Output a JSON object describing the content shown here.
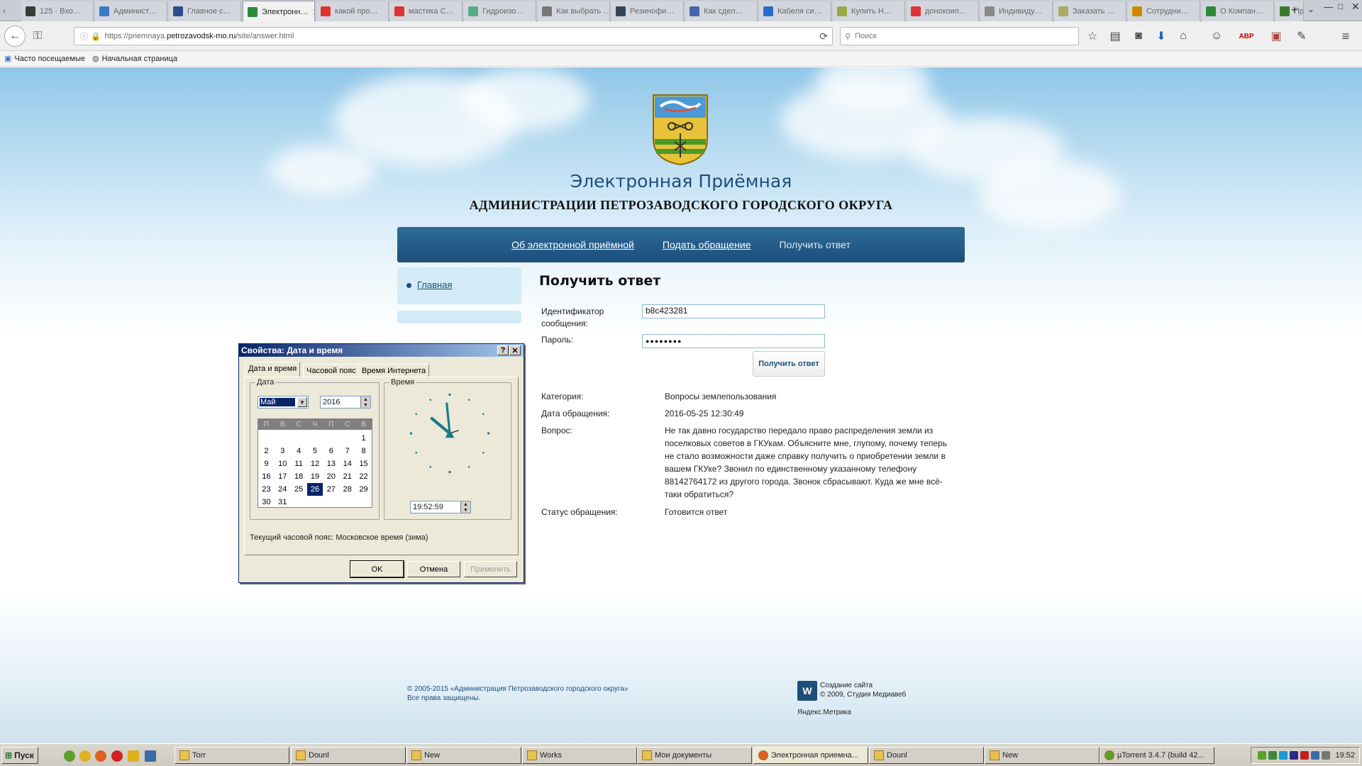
{
  "browser": {
    "tabs": [
      {
        "label": "125 · Вхо…",
        "color": "#3a3a3a"
      },
      {
        "label": "Админист…",
        "color": "#3a7ac8"
      },
      {
        "label": "Главное с…",
        "color": "#2a4f8a"
      },
      {
        "label": "Электронн…",
        "color": "#2a8a3a"
      },
      {
        "label": "какой про…",
        "color": "#d33"
      },
      {
        "label": "мастика С…",
        "color": "#d33"
      },
      {
        "label": "Гидроизо…",
        "color": "#5a8"
      },
      {
        "label": "Как выбрать …",
        "color": "#777"
      },
      {
        "label": "Резинофи…",
        "color": "#345"
      },
      {
        "label": "Как сдел…",
        "color": "#46a"
      },
      {
        "label": "Кабеля си…",
        "color": "#2a6acc"
      },
      {
        "label": "Купить Н…",
        "color": "#9a4"
      },
      {
        "label": "донокоип…",
        "color": "#d33"
      },
      {
        "label": "Индивиду…",
        "color": "#888"
      },
      {
        "label": "Заказать …",
        "color": "#aa6"
      },
      {
        "label": "Сотрудни…",
        "color": "#c80"
      },
      {
        "label": "О Компан…",
        "color": "#2a8a3a"
      },
      {
        "label": "Про…",
        "color": "#3a7a2a"
      }
    ],
    "url_prefix": "https://priemnaya.",
    "url_domain": "petrozavodsk-mo.ru",
    "url_path": "/site/answer.html",
    "search_placeholder": "Поиск",
    "bookmarks": [
      "Часто посещаемые",
      "Начальная страница"
    ]
  },
  "site": {
    "title": "Электронная Приёмная",
    "subtitle": "АДМИНИСТРАЦИИ ПЕТРОЗАВОДСКОГО ГОРОДСКОГО ОКРУГА",
    "menu": [
      "Об электронной приёмной",
      "Подать обращение",
      "Получить ответ"
    ],
    "side_link": "Главная",
    "heading": "Получить ответ",
    "form": {
      "id_label": "Идентификатор сообщения:",
      "id_value": "b8c423281",
      "password_label": "Пароль:",
      "password_value": "●●●●●●●●",
      "button": "Получить ответ"
    },
    "details": {
      "category_label": "Категория:",
      "category_value": "Вопросы землепользования",
      "date_label": "Дата обращения:",
      "date_value": "2016-05-25 12:30:49",
      "question_label": "Вопрос:",
      "question_value": "Не так давно государство передало право распределения земли из поселковых советов в ГКУкам. Объясните мне, глупому, почему теперь не стало возможности даже справку получить о приобретении земли в вашем ГКУке? Звонил по единственному указанному телефону 88142764172 из другого города. Звонок сбрасывают. Куда же мне всё-таки обратиться?",
      "status_label": "Статус обращения:",
      "status_value": "Готовится ответ"
    },
    "footer_left": [
      "© 2005-2015 «Администрация Петрозаводского городского округа»",
      "Все права защищены."
    ],
    "footer_right": [
      "Создание сайта",
      "© 2009, Студия Медиавеб"
    ],
    "metrika": "Яндекс.Метрика"
  },
  "dialog": {
    "title": "Свойства: Дата и время",
    "tabs": [
      "Дата и время",
      "Часовой пояс",
      "Время Интернета"
    ],
    "date_group": "Дата",
    "time_group": "Время",
    "month": "Май",
    "year": "2016",
    "weekdays": [
      "П",
      "В",
      "С",
      "Ч",
      "П",
      "С",
      "В"
    ],
    "days": [
      "",
      "",
      "",
      "",
      "",
      "",
      "1",
      "2",
      "3",
      "4",
      "5",
      "6",
      "7",
      "8",
      "9",
      "10",
      "11",
      "12",
      "13",
      "14",
      "15",
      "16",
      "17",
      "18",
      "19",
      "20",
      "21",
      "22",
      "23",
      "24",
      "25",
      "26",
      "27",
      "28",
      "29",
      "30",
      "31"
    ],
    "selected_day": "26",
    "time": "19:52:59",
    "timezone": "Текущий часовой пояс: Московское время (зима)",
    "buttons": {
      "ok": "OK",
      "cancel": "Отмена",
      "apply": "Применить"
    }
  },
  "taskbar": {
    "start": "Пуск",
    "tasks": [
      "Torr",
      "Dounl",
      "New",
      "Works",
      "Мои документы",
      "Электронная приемна...",
      "Dounl",
      "New",
      "µTorrent 3.4.7 (build 42..."
    ],
    "clock": "19:52"
  }
}
